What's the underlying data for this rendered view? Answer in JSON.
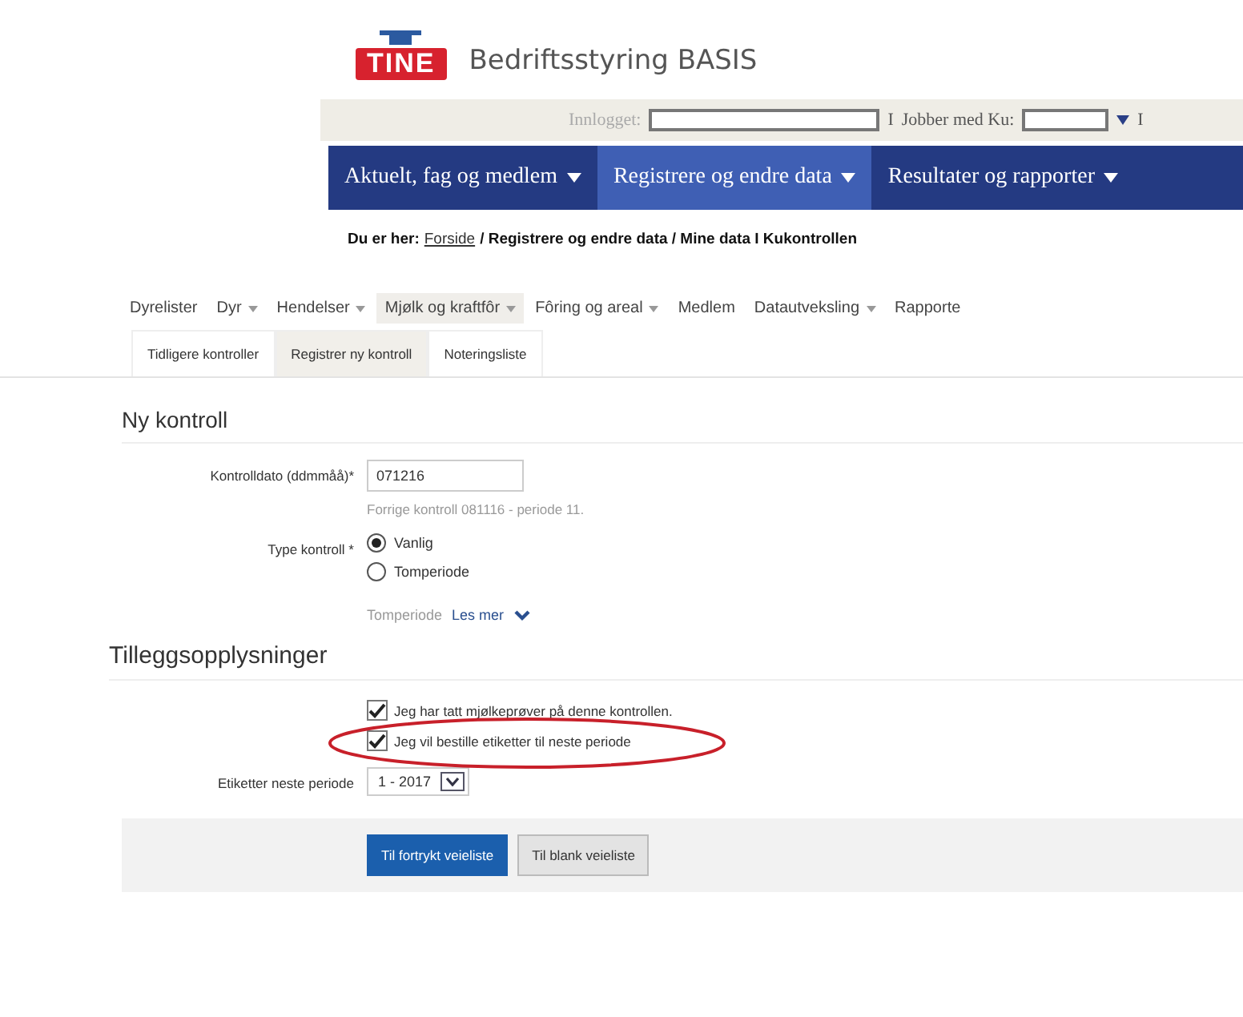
{
  "header": {
    "logo": "TINE",
    "title": "Bedriftsstyring BASIS"
  },
  "user_bar": {
    "logged_in_label": "Innlogget:",
    "separator_1": "I",
    "working_with_label": "Jobber med Ku:",
    "separator_2": "I"
  },
  "nav": [
    {
      "label": "Aktuelt, fag og medlem",
      "selected": false
    },
    {
      "label": "Registrere og endre data",
      "selected": true
    },
    {
      "label": "Resultater og rapporter",
      "selected": false
    }
  ],
  "breadcrumb": {
    "prefix": "Du er her:",
    "link": "Forside",
    "rest": "/ Registrere og endre data / Mine data I Kukontrollen"
  },
  "subnav": [
    {
      "label": "Dyrelister",
      "dropdown": false,
      "selected": false
    },
    {
      "label": "Dyr",
      "dropdown": true,
      "selected": false
    },
    {
      "label": "Hendelser",
      "dropdown": true,
      "selected": false
    },
    {
      "label": "Mjølk og kraftfôr",
      "dropdown": true,
      "selected": true
    },
    {
      "label": "Fôring og areal",
      "dropdown": true,
      "selected": false
    },
    {
      "label": "Medlem",
      "dropdown": false,
      "selected": false
    },
    {
      "label": "Datautveksling",
      "dropdown": true,
      "selected": false
    },
    {
      "label": "Rapporte",
      "dropdown": false,
      "selected": false
    }
  ],
  "tabs": [
    {
      "label": "Tidligere kontroller",
      "selected": false
    },
    {
      "label": "Registrer ny kontroll",
      "selected": true
    },
    {
      "label": "Noteringsliste",
      "selected": false
    }
  ],
  "section_1": {
    "heading": "Ny kontroll",
    "date_label": "Kontrolldato (ddmmåå)*",
    "date_value": "071216",
    "date_hint": "Forrige kontroll 081116 - periode 11.",
    "type_label": "Type kontroll *",
    "type_options": [
      {
        "label": "Vanlig",
        "selected": true
      },
      {
        "label": "Tomperiode",
        "selected": false
      }
    ],
    "info_text": "Tomperiode",
    "info_link": "Les mer"
  },
  "section_2": {
    "heading": "Tilleggsopplysninger",
    "checkboxes": [
      {
        "label": "Jeg har tatt mjølkeprøver på denne kontrollen.",
        "checked": true,
        "circled": false
      },
      {
        "label": "Jeg vil bestille etiketter til neste periode",
        "checked": true,
        "circled": true
      }
    ],
    "labels_label": "Etiketter neste periode",
    "labels_value": "1 - 2017"
  },
  "buttons": [
    {
      "label": "Til fortrykt veieliste",
      "kind": "primary"
    },
    {
      "label": "Til blank veieliste",
      "kind": "secondary"
    }
  ]
}
